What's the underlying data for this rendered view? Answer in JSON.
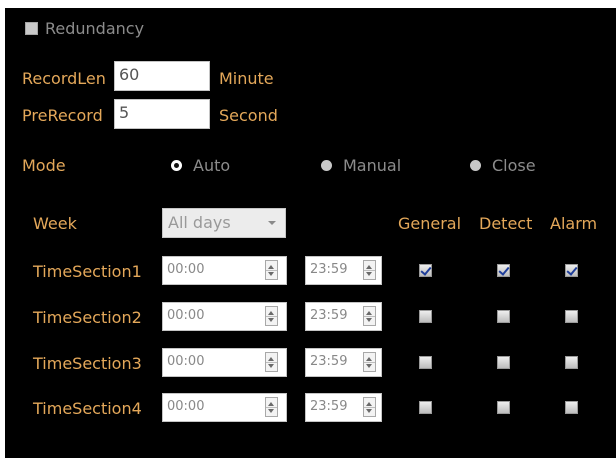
{
  "redundancy": {
    "label": "Redundancy",
    "checked": false
  },
  "record_len": {
    "label": "RecordLen",
    "value": "60",
    "unit": "Minute"
  },
  "pre_record": {
    "label": "PreRecord",
    "value": "5",
    "unit": "Second"
  },
  "mode": {
    "label": "Mode",
    "options": [
      "Auto",
      "Manual",
      "Close"
    ],
    "selected": "Auto"
  },
  "week": {
    "label": "Week",
    "selected": "All days"
  },
  "columns": [
    "General",
    "Detect",
    "Alarm"
  ],
  "time_sections": [
    {
      "label": "TimeSection1",
      "start": "00:00",
      "end": "23:59",
      "general": true,
      "detect": true,
      "alarm": true
    },
    {
      "label": "TimeSection2",
      "start": "00:00",
      "end": "23:59",
      "general": false,
      "detect": false,
      "alarm": false
    },
    {
      "label": "TimeSection3",
      "start": "00:00",
      "end": "23:59",
      "general": false,
      "detect": false,
      "alarm": false
    },
    {
      "label": "TimeSection4",
      "start": "00:00",
      "end": "23:59",
      "general": false,
      "detect": false,
      "alarm": false
    }
  ],
  "colors": {
    "label": "#e4a85a",
    "background": "#000000",
    "disabled_text": "#8c8c8c",
    "check_mark": "#1f3e9a"
  }
}
